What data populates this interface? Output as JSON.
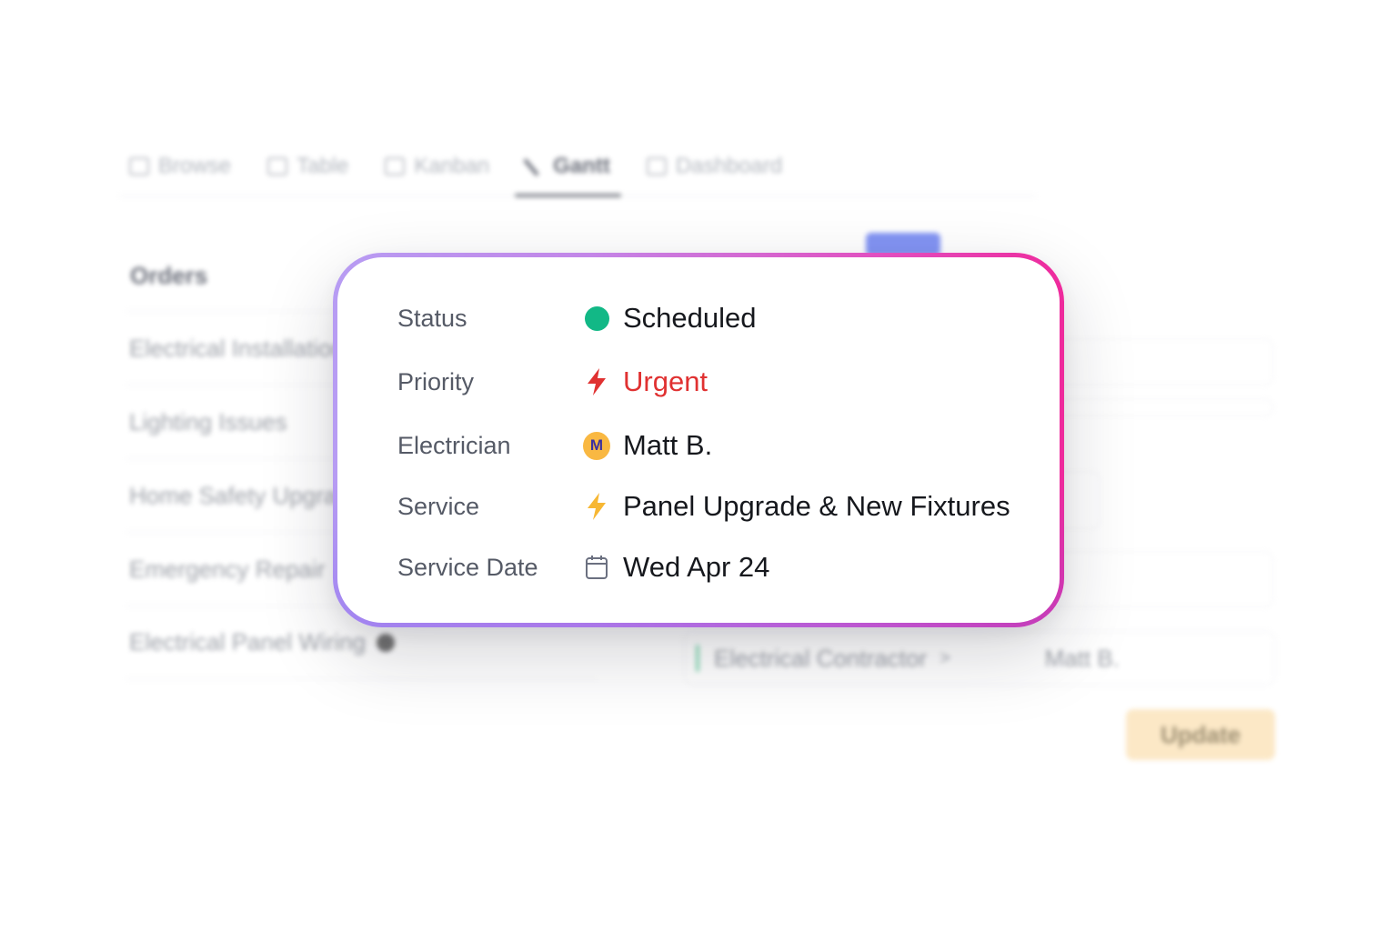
{
  "colors": {
    "status_scheduled": "#12b886",
    "priority_urgent": "#e03131",
    "service_bolt": "#f7b733",
    "avatar_bg": "#f9b842",
    "card_gradient_start": "#b79cf3",
    "card_gradient_end": "#ee2a9c"
  },
  "tabs": [
    {
      "label": "Browse",
      "icon": "folder-icon"
    },
    {
      "label": "Table",
      "icon": "table-icon"
    },
    {
      "label": "Kanban",
      "icon": "kanban-icon"
    },
    {
      "label": "Gantt",
      "icon": "gantt-icon",
      "active": true
    },
    {
      "label": "Dashboard",
      "icon": "dashboard-icon"
    }
  ],
  "orders": {
    "heading": "Orders",
    "items": [
      "Electrical Installation",
      "Lighting Issues",
      "Home Safety Upgrade",
      "Emergency Repair",
      "Electrical Panel Wiring"
    ]
  },
  "contractor": {
    "label": "Electrical Contractor",
    "separator": ">",
    "assignee": "Matt B."
  },
  "update_button": "Update",
  "details": {
    "status": {
      "label": "Status",
      "value": "Scheduled"
    },
    "priority": {
      "label": "Priority",
      "value": "Urgent",
      "icon": "lightning-icon"
    },
    "electrician": {
      "label": "Electrician",
      "value": "Matt B.",
      "avatar_initial": "M"
    },
    "service": {
      "label": "Service",
      "value": "Panel Upgrade & New Fixtures",
      "icon": "lightning-icon"
    },
    "service_date": {
      "label": "Service Date",
      "value": "Wed Apr 24",
      "icon": "calendar-icon"
    }
  }
}
